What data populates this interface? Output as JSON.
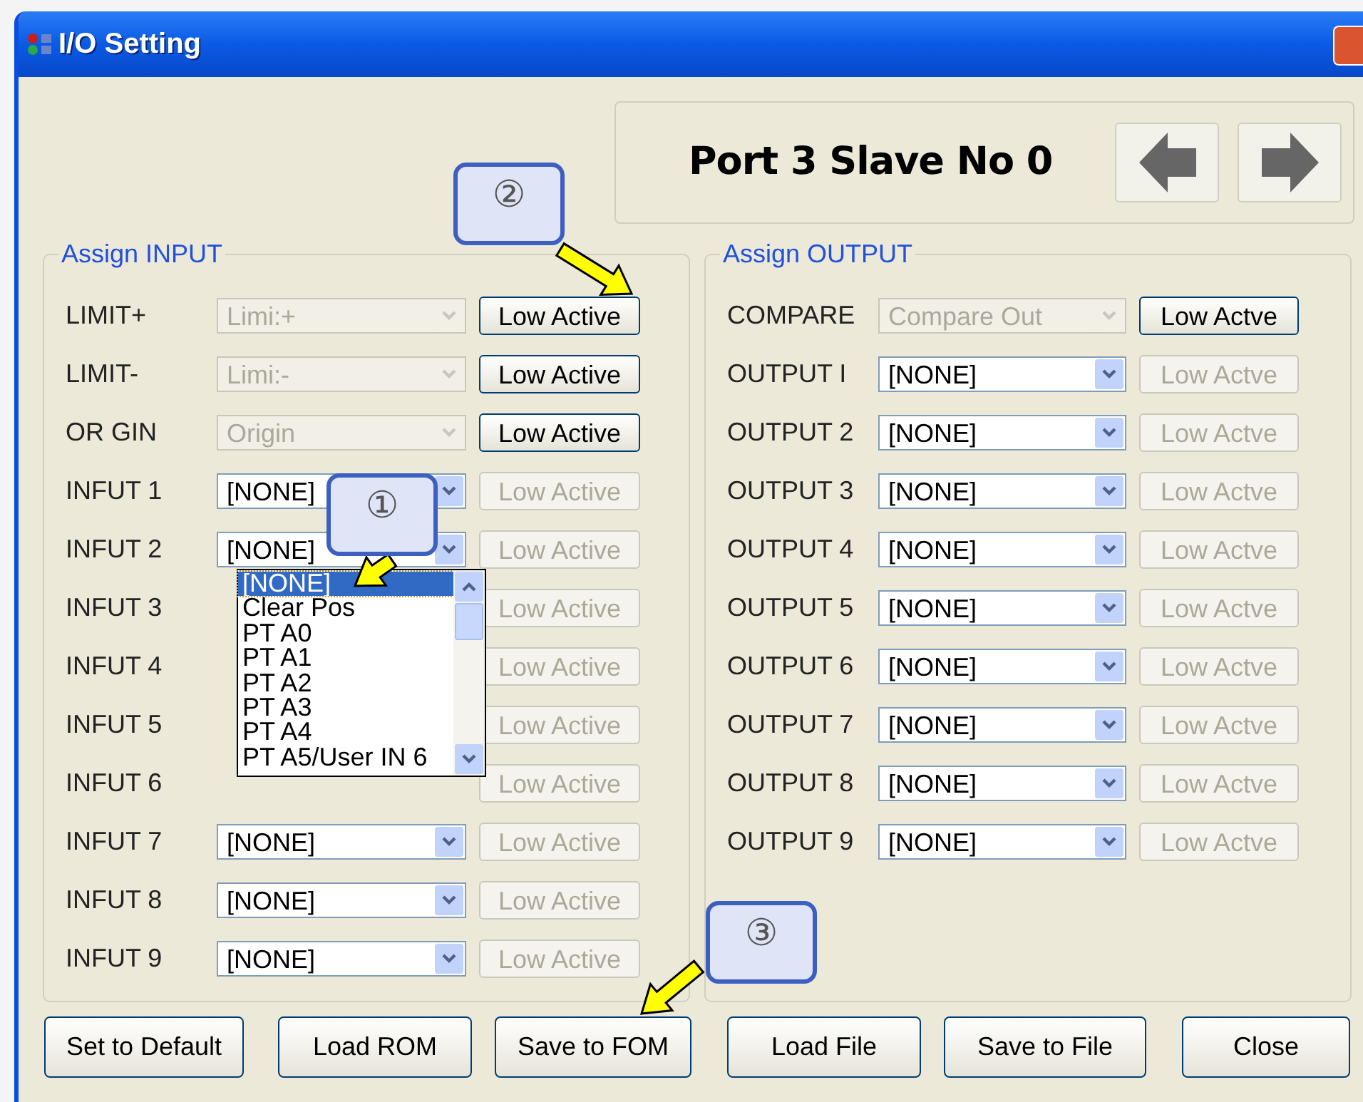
{
  "window": {
    "title": "I/O Setting"
  },
  "header": {
    "title": "Port 3 Slave No 0"
  },
  "input_group": {
    "title": "Assign INPUT",
    "rows": [
      {
        "label": "LIMIT+",
        "value": "Limi:+",
        "combo_enabled": false,
        "button": "Low Active",
        "button_enabled": true
      },
      {
        "label": "LIMIT-",
        "value": "Limi:-",
        "combo_enabled": false,
        "button": "Low Active",
        "button_enabled": true
      },
      {
        "label": "OR GIN",
        "value": "Origin",
        "combo_enabled": false,
        "button": "Low Active",
        "button_enabled": true
      },
      {
        "label": "INFUT 1",
        "value": "[NONE]",
        "combo_enabled": true,
        "button": "Low Active",
        "button_enabled": false
      },
      {
        "label": "INFUT 2",
        "value": "[NONE]",
        "combo_enabled": true,
        "button": "Low Active",
        "button_enabled": false
      },
      {
        "label": "INFUT 3",
        "button": "Low Active",
        "button_enabled": false
      },
      {
        "label": "INFUT 4",
        "button": "Low Active",
        "button_enabled": false
      },
      {
        "label": "INFUT 5",
        "button": "Low Active",
        "button_enabled": false
      },
      {
        "label": "INFUT 6",
        "button": "Low Active",
        "button_enabled": false
      },
      {
        "label": "INFUT 7",
        "value": "[NONE]",
        "combo_enabled": true,
        "button": "Low Active",
        "button_enabled": false
      },
      {
        "label": "INFUT 8",
        "value": "[NONE]",
        "combo_enabled": true,
        "button": "Low Active",
        "button_enabled": false
      },
      {
        "label": "INFUT 9",
        "value": "[NONE]",
        "combo_enabled": true,
        "button": "Low Active",
        "button_enabled": false
      }
    ]
  },
  "dropdown_list": {
    "items": [
      {
        "label": "[NONE]",
        "selected": true
      },
      {
        "label": "Clear Pos",
        "selected": false
      },
      {
        "label": "PT A0",
        "selected": false
      },
      {
        "label": "PT A1",
        "selected": false
      },
      {
        "label": "PT A2",
        "selected": false
      },
      {
        "label": "PT A3",
        "selected": false
      },
      {
        "label": "PT A4",
        "selected": false
      },
      {
        "label": "PT A5/User IN 6",
        "selected": false
      }
    ]
  },
  "output_group": {
    "title": "Assign OUTPUT",
    "rows": [
      {
        "label": "COMPARE",
        "value": "Compare Out",
        "combo_enabled": false,
        "button": "Low Actve",
        "button_enabled": true
      },
      {
        "label": "OUTPUT I",
        "value": "[NONE]",
        "combo_enabled": true,
        "button": "Low Actve",
        "button_enabled": false
      },
      {
        "label": "OUTPUT 2",
        "value": "[NONE]",
        "combo_enabled": true,
        "button": "Low Actve",
        "button_enabled": false
      },
      {
        "label": "OUTPUT 3",
        "value": "[NONE]",
        "combo_enabled": true,
        "button": "Low Actve",
        "button_enabled": false
      },
      {
        "label": "OUTPUT 4",
        "value": "[NONE]",
        "combo_enabled": true,
        "button": "Low Actve",
        "button_enabled": false
      },
      {
        "label": "OUTPUT 5",
        "value": "[NONE]",
        "combo_enabled": true,
        "button": "Low Actve",
        "button_enabled": false
      },
      {
        "label": "OUTPUT 6",
        "value": "[NONE]",
        "combo_enabled": true,
        "button": "Low Actve",
        "button_enabled": false
      },
      {
        "label": "OUTPUT 7",
        "value": "[NONE]",
        "combo_enabled": true,
        "button": "Low Actve",
        "button_enabled": false
      },
      {
        "label": "OUTPUT 8",
        "value": "[NONE]",
        "combo_enabled": true,
        "button": "Low Actve",
        "button_enabled": false
      },
      {
        "label": "OUTPUT 9",
        "value": "[NONE]",
        "combo_enabled": true,
        "button": "Low Actve",
        "button_enabled": false
      }
    ]
  },
  "buttons": [
    "Set to Default",
    "Load ROM",
    "Save to FOM",
    "Load File",
    "Save to File",
    "Close"
  ],
  "callouts": [
    {
      "label": "②"
    },
    {
      "label": "①"
    },
    {
      "label": "③"
    }
  ]
}
